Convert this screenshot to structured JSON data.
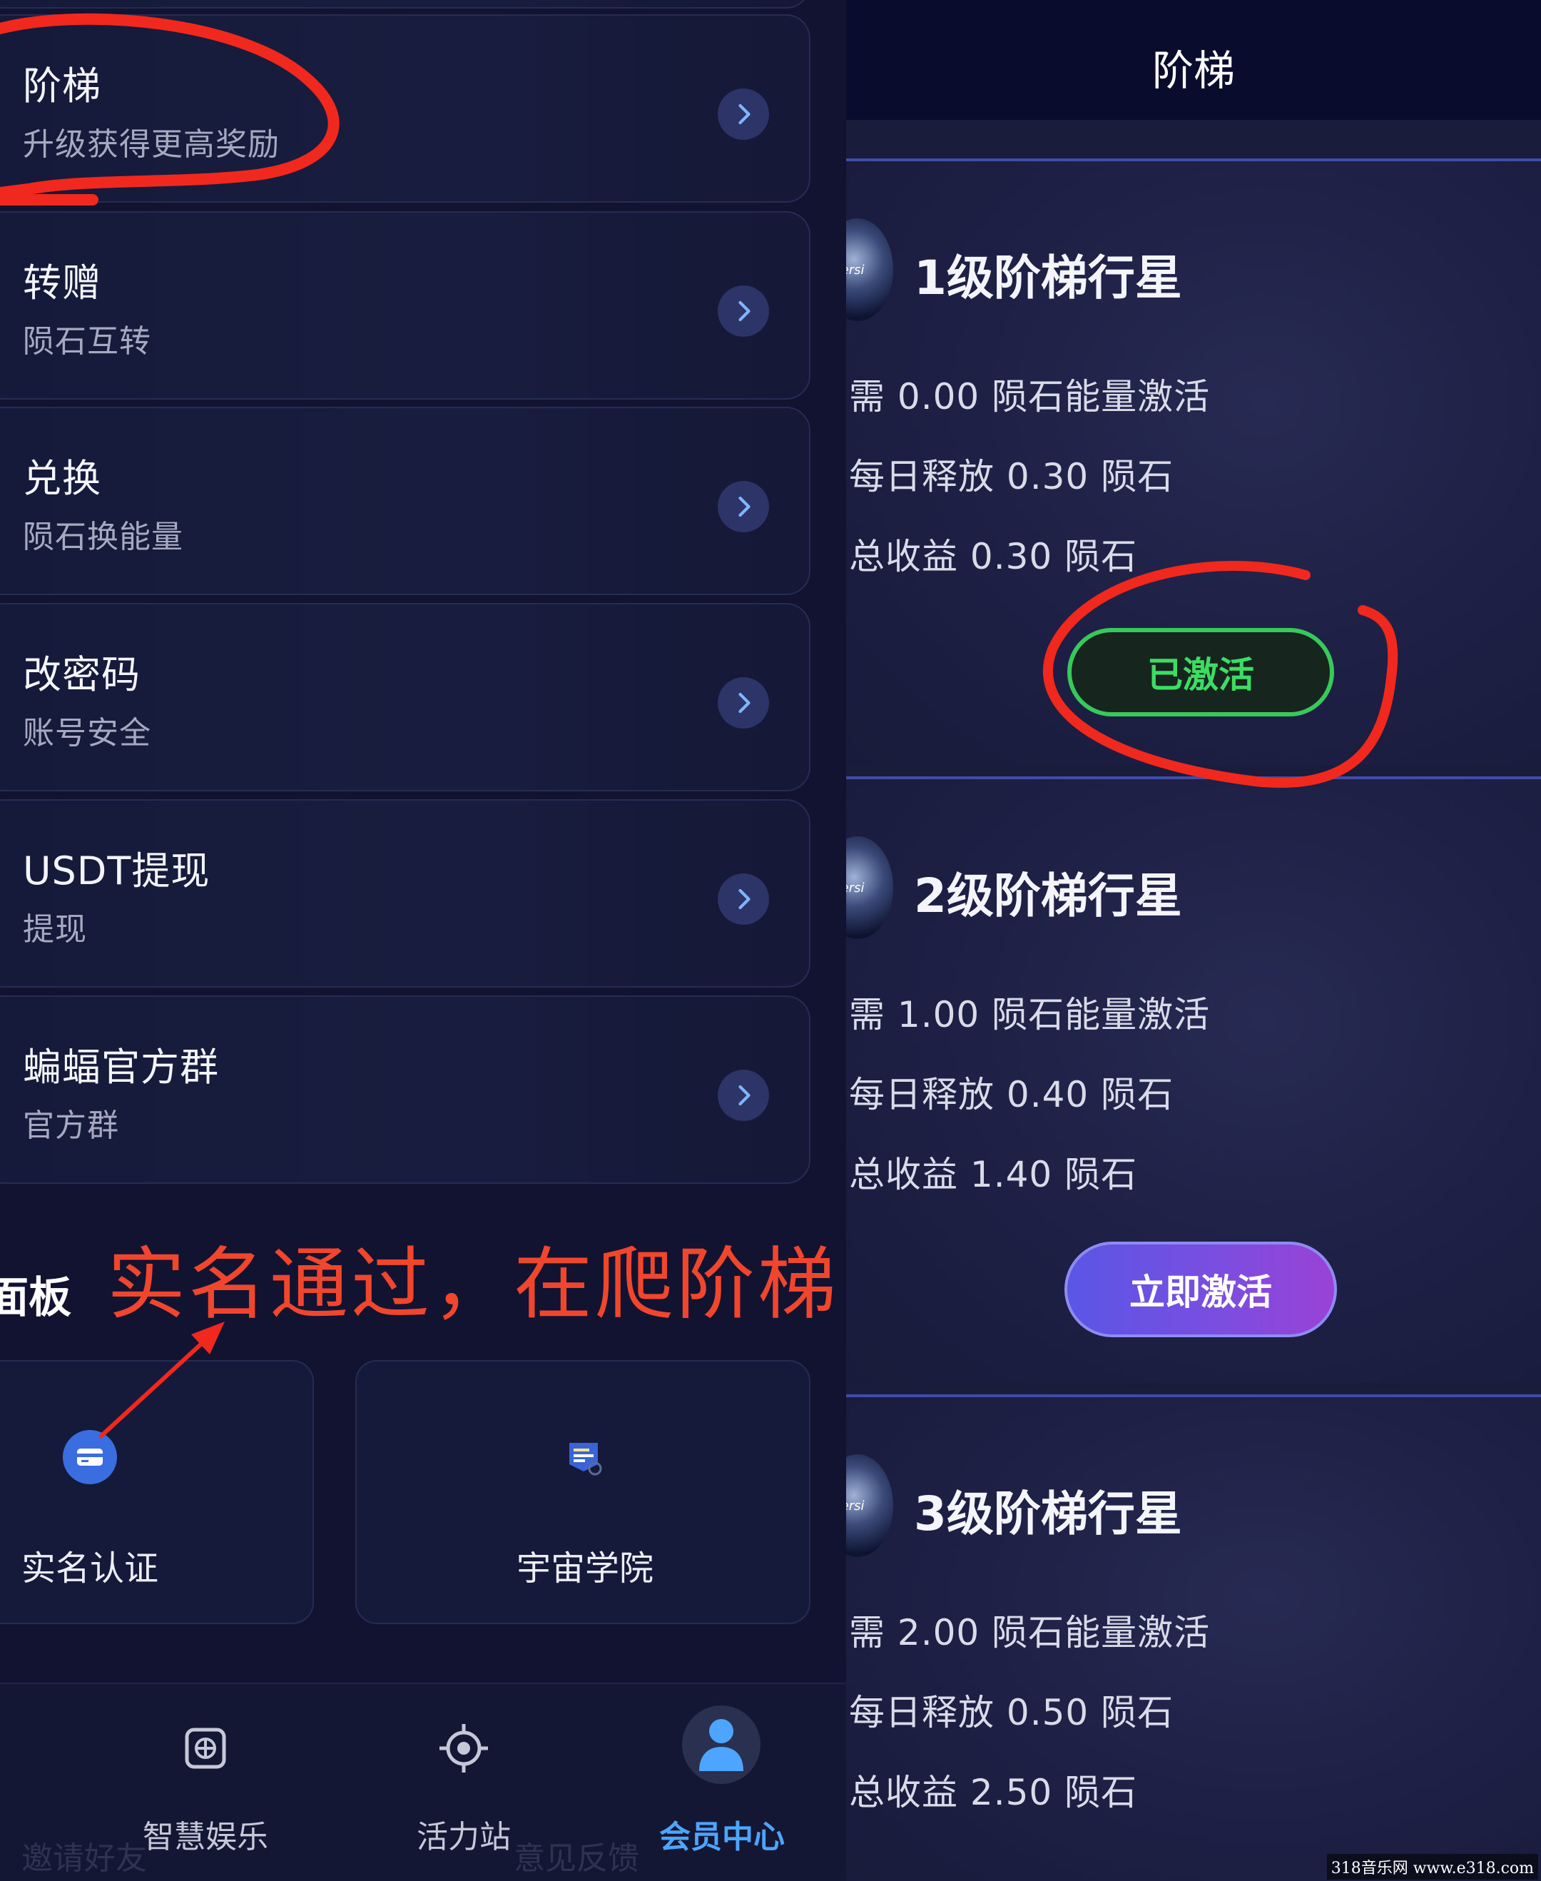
{
  "left": {
    "menu": [
      {
        "title": "阶梯",
        "subtitle": "升级获得更高奖励"
      },
      {
        "title": "转赠",
        "subtitle": "陨石互转"
      },
      {
        "title": "兑换",
        "subtitle": "陨石换能量"
      },
      {
        "title": "改密码",
        "subtitle": "账号安全"
      },
      {
        "title": "USDT提现",
        "subtitle": "提现"
      },
      {
        "title": "蝙蝠官方群",
        "subtitle": "官方群"
      }
    ],
    "section_title": "面板",
    "annotation": "实名通过，在爬阶梯",
    "tiles": [
      {
        "label": "实名认证",
        "icon": "id-card-icon"
      },
      {
        "label": "宇宙学院",
        "icon": "academy-icon"
      }
    ],
    "ghost_labels": [
      "邀请好友",
      "意见反馈"
    ],
    "bottom_nav": [
      {
        "label": "智慧娱乐",
        "icon": "grid-icon"
      },
      {
        "label": "活力站",
        "icon": "target-icon"
      },
      {
        "label": "会员中心",
        "icon": "user-icon",
        "active": true
      }
    ]
  },
  "right": {
    "header_title": "阶梯",
    "levels": [
      {
        "name": "1级阶梯行星",
        "requirement": "需 0.00 陨石能量激活",
        "daily": "每日释放 0.30 陨石",
        "total": "总收益 0.30 陨石",
        "button": "已激活",
        "status": "activated"
      },
      {
        "name": "2级阶梯行星",
        "requirement": "需 1.00 陨石能量激活",
        "daily": "每日释放 0.40 陨石",
        "total": "总收益 1.40 陨石",
        "button": "立即激活",
        "status": "inactive"
      },
      {
        "name": "3级阶梯行星",
        "requirement": "需 2.00 陨石能量激活",
        "daily": "每日释放 0.50 陨石",
        "total": "总收益 2.50 陨石",
        "button": "",
        "status": "inactive"
      }
    ],
    "planet_text": "versi"
  },
  "watermark": "318音乐网 www.e318.com",
  "colors": {
    "annotation_red": "#f0462e",
    "active_green": "#3ddc62",
    "nav_active": "#4ea5ff",
    "accent_purple": "#7a4ee0"
  }
}
